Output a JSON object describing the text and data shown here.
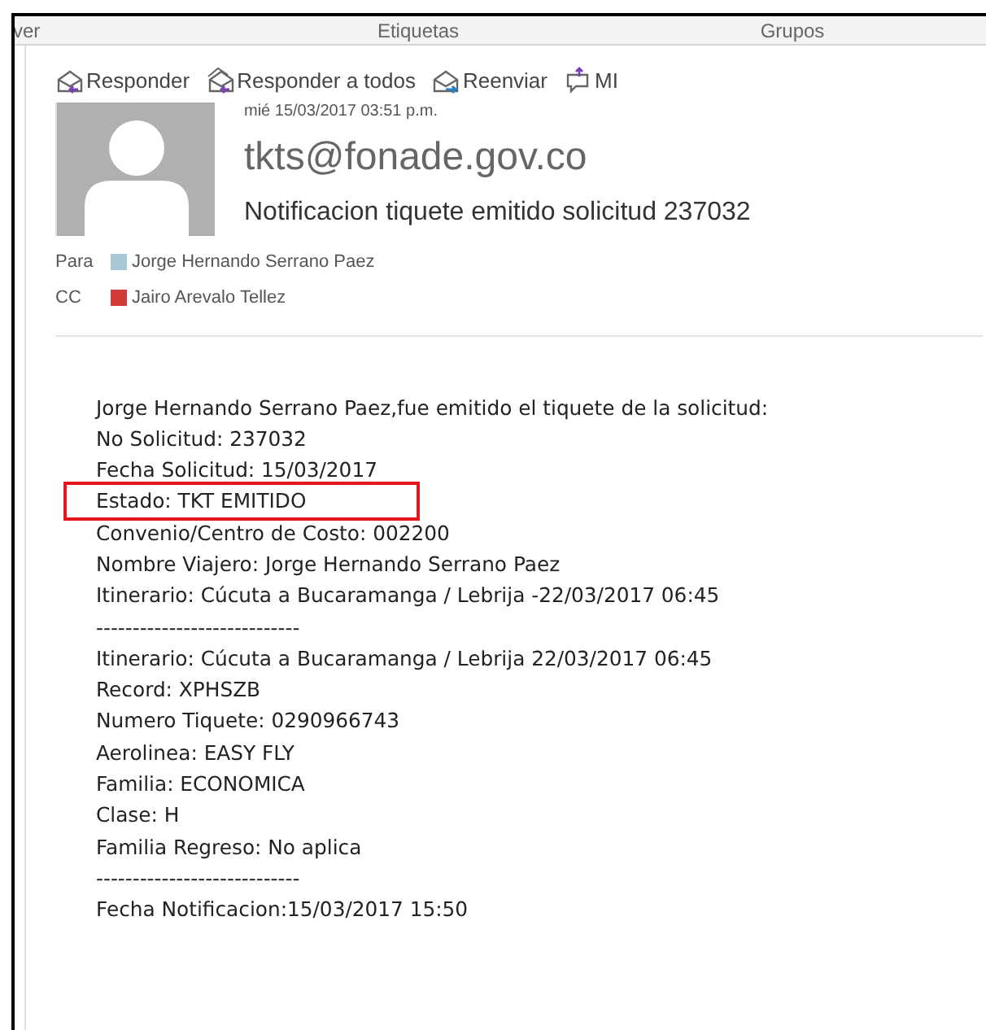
{
  "ribbon": {
    "groups": [
      "ver",
      "Etiquetas",
      "Grupos"
    ]
  },
  "actions": [
    {
      "kind": "reply",
      "label": "Responder"
    },
    {
      "kind": "reply_all",
      "label": "Responder a todos"
    },
    {
      "kind": "forward",
      "label": "Reenviar"
    },
    {
      "kind": "im",
      "label": "MI"
    }
  ],
  "message": {
    "date": "mié 15/03/2017 03:51 p.m.",
    "sender": "tkts@fonade.gov.co",
    "subject": "Notificacion tiquete emitido solicitud 237032",
    "recipients": [
      {
        "field": "Para",
        "name": "Jorge Hernando Serrano Paez",
        "color": "#a9c8d6"
      },
      {
        "field": "CC",
        "name": "Jairo Arevalo Tellez",
        "color": "#d23a3a"
      }
    ]
  },
  "body": [
    {
      "text": "Jorge Hernando Serrano Paez,fue emitido el tiquete de la solicitud:",
      "highlighted": false
    },
    {
      "text": "No Solicitud: 237032",
      "highlighted": false
    },
    {
      "text": "Fecha Solicitud: 15/03/2017",
      "highlighted": false
    },
    {
      "text": "Estado: TKT EMITIDO",
      "highlighted": true
    },
    {
      "text": "Convenio/Centro de Costo: 002200",
      "highlighted": false
    },
    {
      "text": "Nombre Viajero: Jorge Hernando Serrano Paez",
      "highlighted": false
    },
    {
      "text": "Itinerario: Cúcuta a Bucaramanga / Lebrija -22/03/2017 06:45",
      "highlighted": false
    },
    {
      "text": "----------------------------",
      "highlighted": false
    },
    {
      "text": "Itinerario: Cúcuta a Bucaramanga / Lebrija 22/03/2017 06:45",
      "highlighted": false
    },
    {
      "text": "Record: XPHSZB",
      "highlighted": false
    },
    {
      "text": "Numero Tiquete: 0290966743",
      "highlighted": false
    },
    {
      "text": "Aerolinea: EASY FLY",
      "highlighted": false
    },
    {
      "text": "Familia: ECONOMICA",
      "highlighted": false
    },
    {
      "text": "Clase: H",
      "highlighted": false
    },
    {
      "text": "Familia Regreso: No aplica",
      "highlighted": false
    },
    {
      "text": "----------------------------",
      "highlighted": false
    },
    {
      "text": "Fecha Notificacion:15/03/2017 15:50",
      "highlighted": false
    }
  ]
}
